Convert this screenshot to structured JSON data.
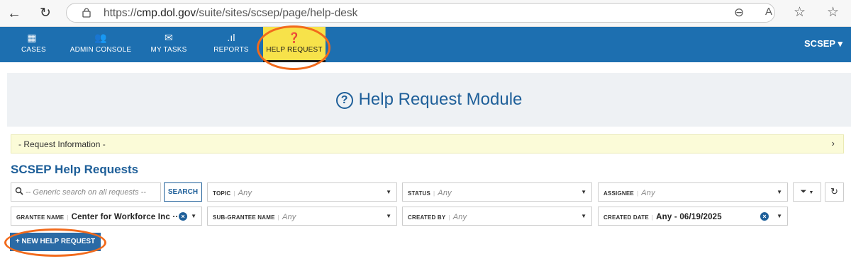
{
  "browser": {
    "url_prefix": "https://",
    "url_domain": "cmp.dol.gov",
    "url_path": "/suite/sites/scsep/page/help-desk",
    "back_icon": "←",
    "refresh_icon": "↻",
    "zoom_icon": "⊖",
    "read_aloud_icon": "A",
    "favorite_icon": "☆",
    "favorites_bar_icon": "☆"
  },
  "nav": {
    "items": [
      {
        "label": "CASES",
        "icon": "▦"
      },
      {
        "label": "ADMIN CONSOLE",
        "icon": "👥"
      },
      {
        "label": "MY TASKS",
        "icon": "✉"
      },
      {
        "label": "REPORTS",
        "icon": ".ıl"
      },
      {
        "label": "HELP REQUEST",
        "icon": "❓"
      }
    ],
    "active": "HELP REQUEST",
    "user_menu": "SCSEP ▾"
  },
  "page": {
    "title": "Help Request Module",
    "request_info": "- Request Information -",
    "request_info_chevron": "›",
    "section_title": "SCSEP Help Requests"
  },
  "filters": {
    "search_placeholder": "-- Generic search on all requests --",
    "search_button": "SEARCH",
    "topic": {
      "label": "TOPIC",
      "value": "Any"
    },
    "status": {
      "label": "STATUS",
      "value": "Any"
    },
    "assignee": {
      "label": "ASSIGNEE",
      "value": "Any"
    },
    "grantee_name": {
      "label": "GRANTEE NAME",
      "value": "Center for Workforce Inc ···"
    },
    "sub_grantee_name": {
      "label": "SUB-GRANTEE NAME",
      "value": "Any"
    },
    "created_by": {
      "label": "CREATED BY",
      "value": "Any"
    },
    "created_date": {
      "label": "CREATED DATE",
      "value": "Any - 06/19/2025"
    },
    "filter_icon": "▼",
    "refresh_icon": "↻"
  },
  "actions": {
    "new_request": "+ NEW HELP REQUEST"
  },
  "colors": {
    "nav_bg": "#1d6fb0",
    "active_tab_bg": "#f7e24a",
    "highlight_oval": "#f26a1b",
    "brand_text": "#1e5f99"
  }
}
